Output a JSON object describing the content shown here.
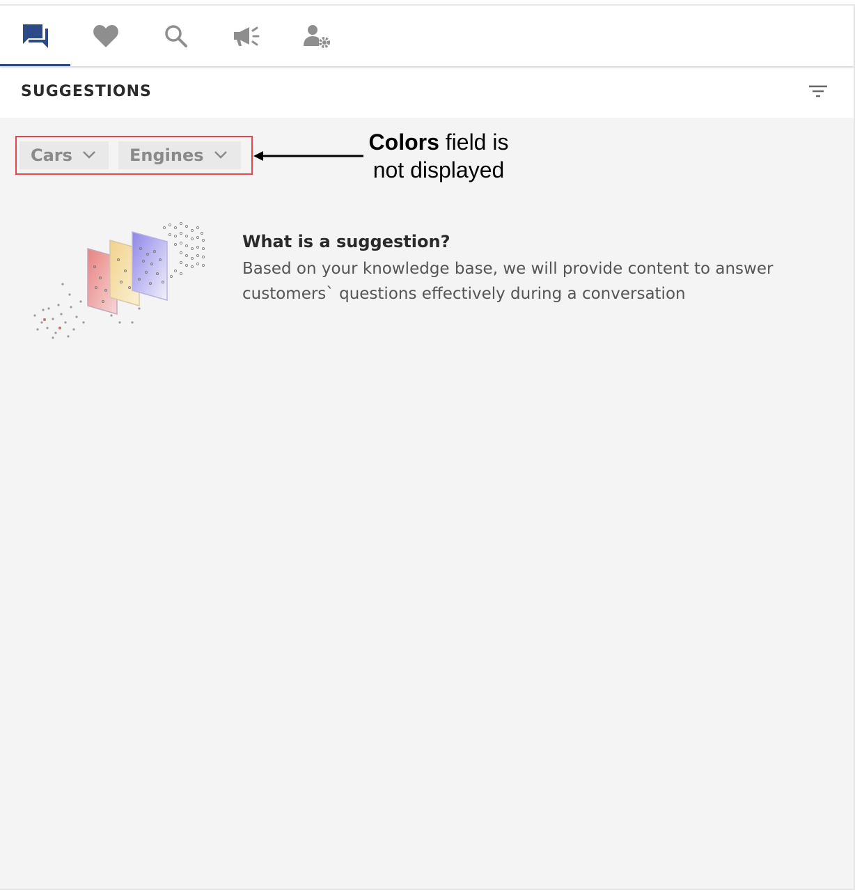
{
  "tabs": [
    {
      "icon": "chat-icon",
      "active": true
    },
    {
      "icon": "heart-icon",
      "active": false
    },
    {
      "icon": "search-icon",
      "active": false
    },
    {
      "icon": "megaphone-icon",
      "active": false
    },
    {
      "icon": "user-settings-icon",
      "active": false
    }
  ],
  "colors": {
    "active_tab": "#2c4a86",
    "icon_gray": "#8e8e8e",
    "highlight_box": "#e0484e"
  },
  "section": {
    "title": "SUGGESTIONS",
    "filter_icon": "filter-icon"
  },
  "chips": [
    {
      "label": "Cars"
    },
    {
      "label": "Engines"
    }
  ],
  "annotation": {
    "bold": "Colors",
    "rest_line1": " field is",
    "line2": "not displayed"
  },
  "info": {
    "title": "What is a suggestion?",
    "body": "Based on your knowledge base, we will provide content to answer customers`  questions effectively during a conversation"
  }
}
